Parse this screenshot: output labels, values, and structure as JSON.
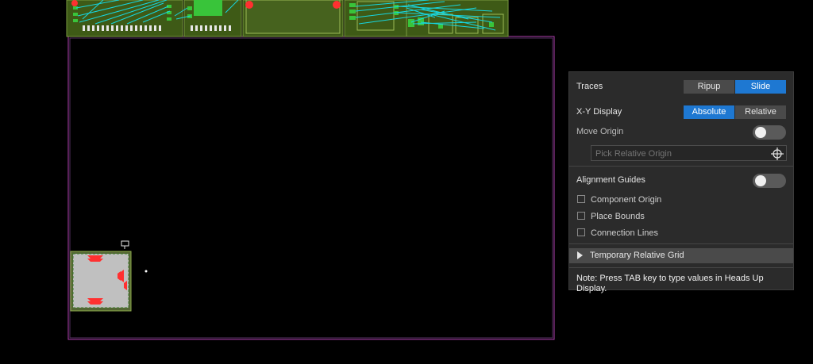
{
  "panel": {
    "traces": {
      "label": "Traces",
      "options": [
        "Ripup",
        "Slide"
      ],
      "selected": "Slide"
    },
    "xy_display": {
      "label": "X-Y Display",
      "options": [
        "Absolute",
        "Relative"
      ],
      "selected": "Absolute"
    },
    "move_origin": {
      "label": "Move Origin",
      "enabled": false
    },
    "pick_origin": {
      "placeholder": "Pick Relative Origin"
    },
    "alignment_guides": {
      "label": "Alignment Guides",
      "enabled": false
    },
    "checkboxes": [
      {
        "label": "Component Origin",
        "checked": false
      },
      {
        "label": "Place Bounds",
        "checked": false
      },
      {
        "label": "Connection Lines",
        "checked": false
      }
    ],
    "temporary_grid": {
      "label": "Temporary Relative Grid",
      "expanded": false
    },
    "note": "Note: Press TAB key to type values in Heads Up Display."
  },
  "colors": {
    "accent": "#1e78d2",
    "board_outline": "#b040b0",
    "trace": "#17d6e0",
    "pad": "#ff3030",
    "component_fill": "#4f6b1d"
  }
}
